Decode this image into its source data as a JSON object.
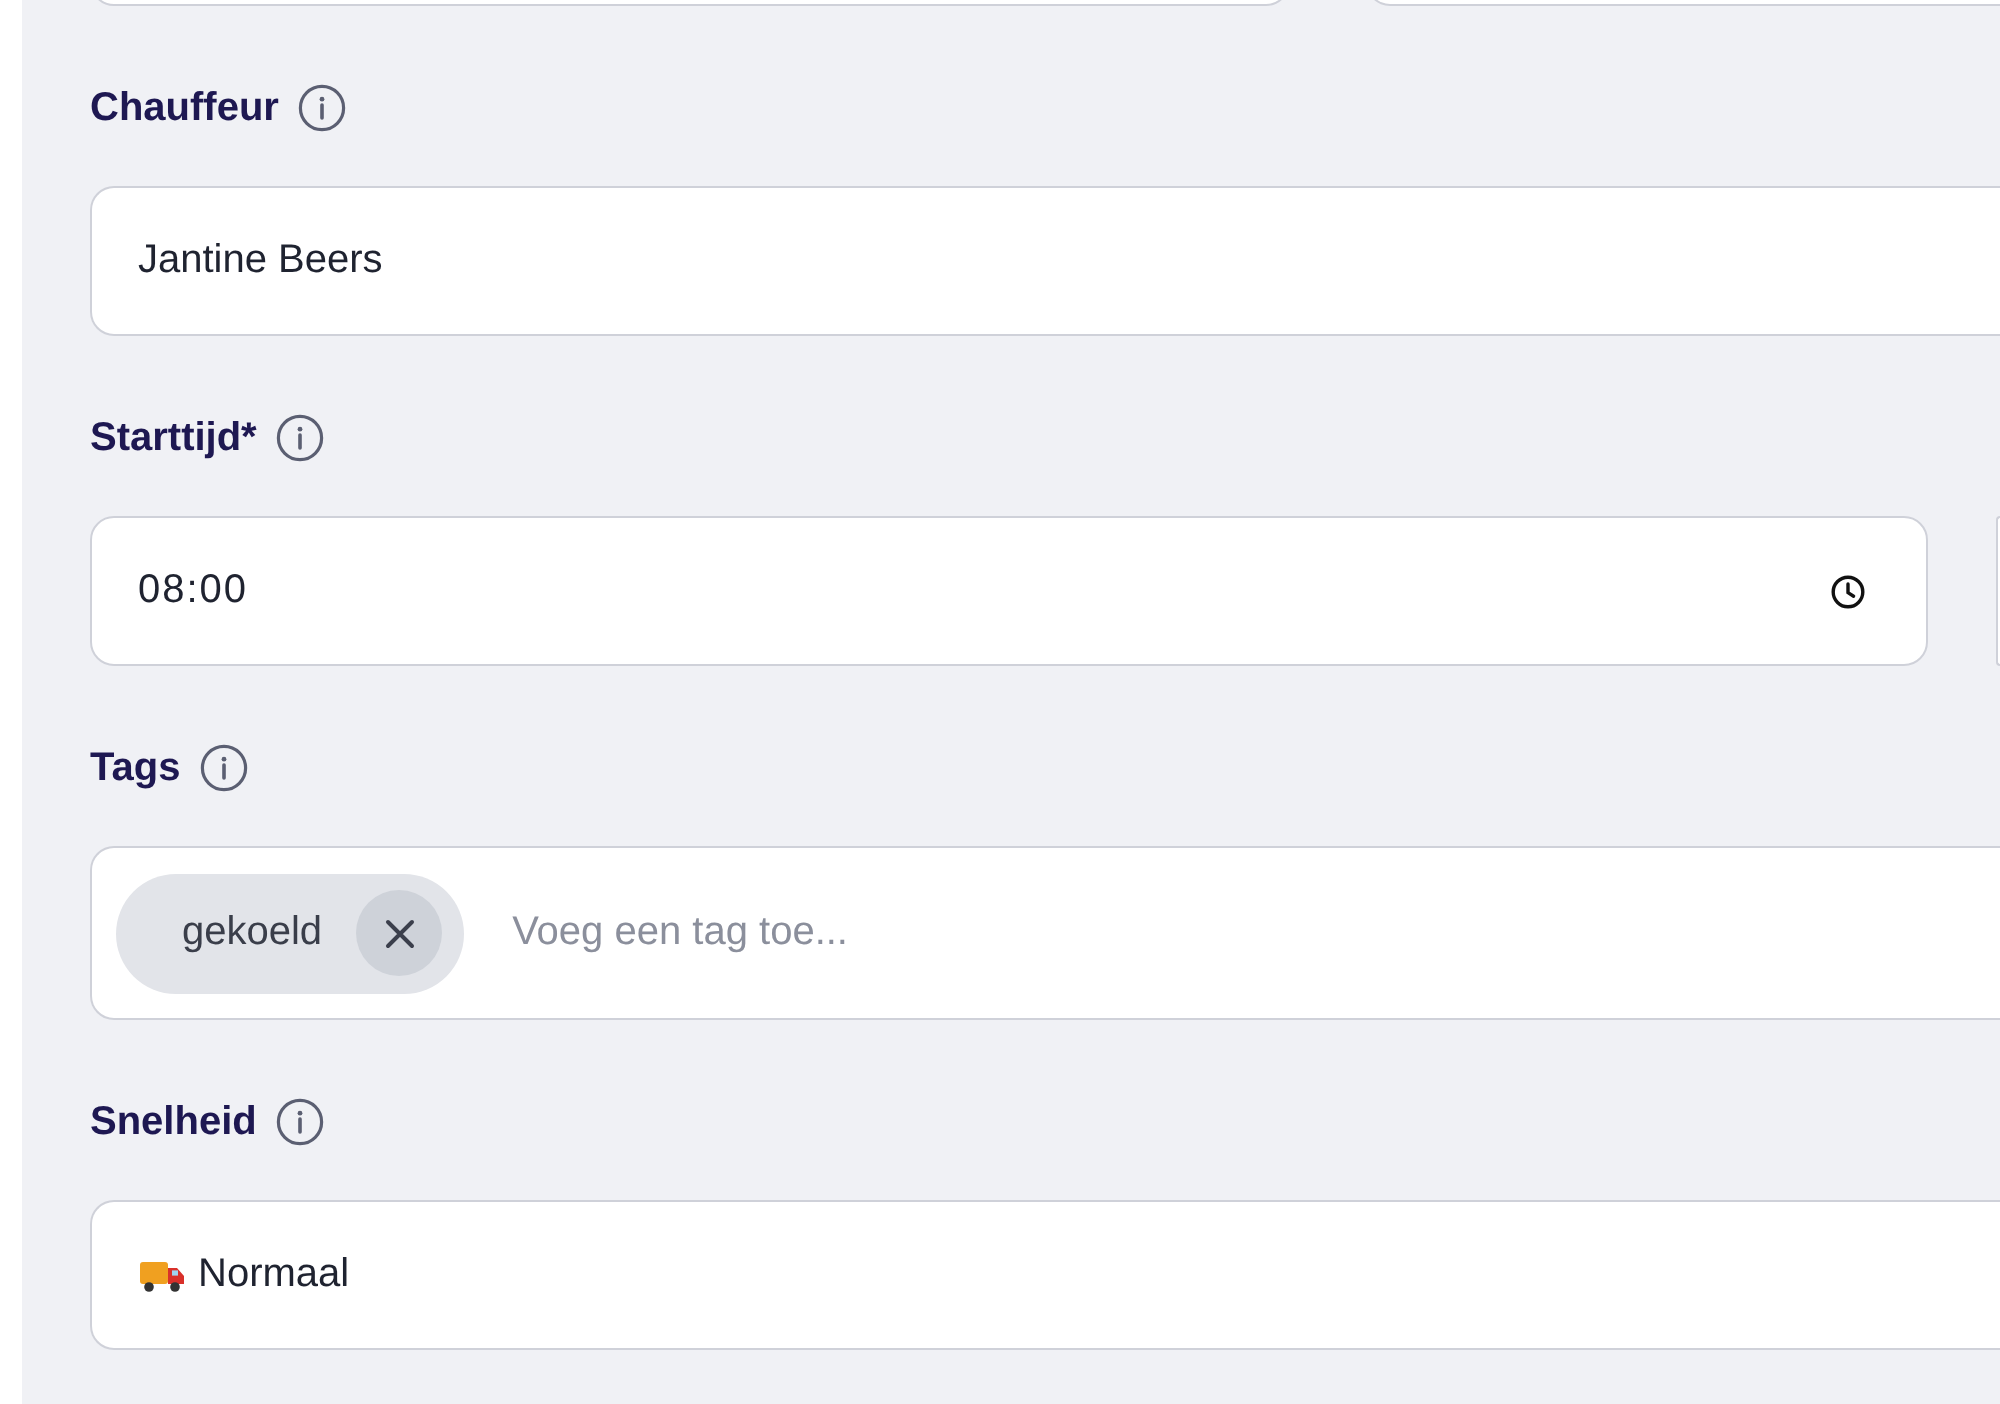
{
  "fields": [
    {
      "kind": "text",
      "label": "Chauffeur",
      "value": "Jantine Beers"
    },
    {
      "kind": "time",
      "label": "Starttijd*",
      "value": "08:00"
    },
    {
      "kind": "tags",
      "label": "Tags",
      "tags": [
        "gekoeld"
      ],
      "placeholder": "Voeg een tag toe..."
    },
    {
      "kind": "select",
      "label": "Snelheid",
      "value": "Normaal"
    }
  ]
}
